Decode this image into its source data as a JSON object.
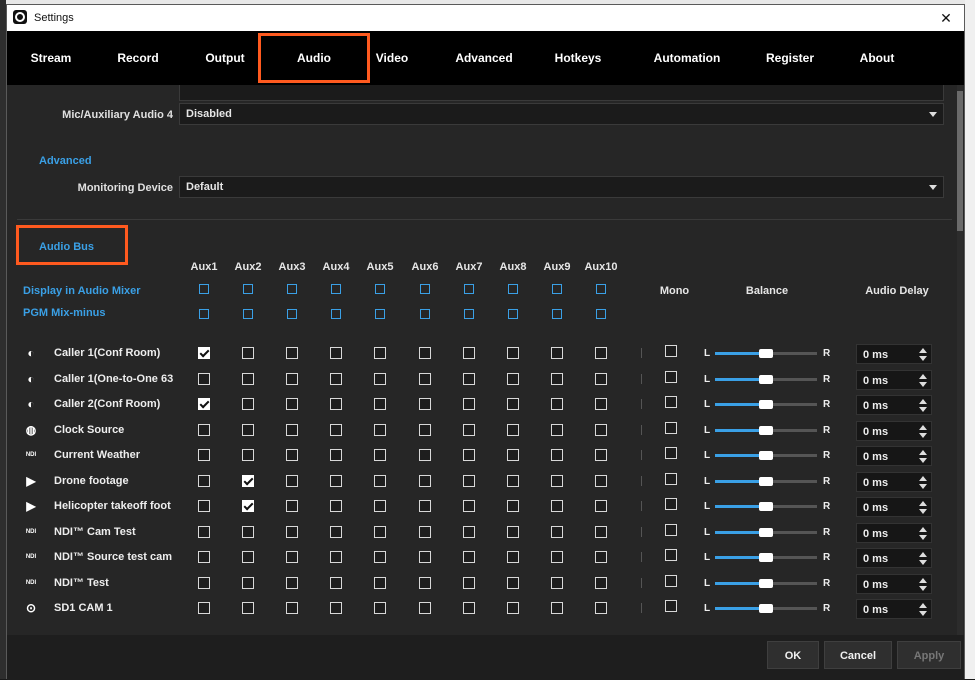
{
  "window": {
    "title": "Settings",
    "close_glyph": "✕"
  },
  "tabs": [
    {
      "label": "Stream"
    },
    {
      "label": "Record"
    },
    {
      "label": "Output"
    },
    {
      "label": "Audio"
    },
    {
      "label": "Video"
    },
    {
      "label": "Advanced"
    },
    {
      "label": "Hotkeys"
    },
    {
      "label": "Automation"
    },
    {
      "label": "Register"
    },
    {
      "label": "About"
    }
  ],
  "active_tab": "Audio",
  "mic_aux4": {
    "label": "Mic/Auxiliary Audio 4",
    "value": "Disabled"
  },
  "advanced": {
    "heading": "Advanced",
    "monitoring_label": "Monitoring Device",
    "monitoring_value": "Default"
  },
  "audio_bus": {
    "heading": "Audio Bus",
    "aux_headers": [
      "Aux1",
      "Aux2",
      "Aux3",
      "Aux4",
      "Aux5",
      "Aux6",
      "Aux7",
      "Aux8",
      "Aux9",
      "Aux10"
    ],
    "display_in_mixer_label": "Display in Audio Mixer",
    "pgm_mix_minus_label": "PGM Mix-minus",
    "mono_header": "Mono",
    "balance_header": "Balance",
    "delay_header": "Audio Delay",
    "balance_left": "L",
    "balance_right": "R",
    "sources": [
      {
        "name": "Caller 1(Conf Room)",
        "icon": "caller-icon",
        "aux": [
          true,
          false,
          false,
          false,
          false,
          false,
          false,
          false,
          false,
          false
        ],
        "mono": false,
        "balance": 0,
        "delay": "0 ms"
      },
      {
        "name": "Caller 1(One-to-One 63",
        "icon": "caller-icon",
        "aux": [
          false,
          false,
          false,
          false,
          false,
          false,
          false,
          false,
          false,
          false
        ],
        "mono": false,
        "balance": 0,
        "delay": "0 ms"
      },
      {
        "name": "Caller 2(Conf Room)",
        "icon": "caller-icon",
        "aux": [
          true,
          false,
          false,
          false,
          false,
          false,
          false,
          false,
          false,
          false
        ],
        "mono": false,
        "balance": 0,
        "delay": "0 ms"
      },
      {
        "name": "Clock Source",
        "icon": "globe-icon",
        "aux": [
          false,
          false,
          false,
          false,
          false,
          false,
          false,
          false,
          false,
          false
        ],
        "mono": false,
        "balance": 0,
        "delay": "0 ms"
      },
      {
        "name": "Current Weather",
        "icon": "ndi-icon",
        "aux": [
          false,
          false,
          false,
          false,
          false,
          false,
          false,
          false,
          false,
          false
        ],
        "mono": false,
        "balance": 0,
        "delay": "0 ms"
      },
      {
        "name": "Drone footage",
        "icon": "play-icon",
        "aux": [
          false,
          true,
          false,
          false,
          false,
          false,
          false,
          false,
          false,
          false
        ],
        "mono": false,
        "balance": 0,
        "delay": "0 ms"
      },
      {
        "name": "Helicopter takeoff foot",
        "icon": "play-icon",
        "aux": [
          false,
          true,
          false,
          false,
          false,
          false,
          false,
          false,
          false,
          false
        ],
        "mono": false,
        "balance": 0,
        "delay": "0 ms"
      },
      {
        "name": "NDI™ Cam Test",
        "icon": "ndi-icon",
        "aux": [
          false,
          false,
          false,
          false,
          false,
          false,
          false,
          false,
          false,
          false
        ],
        "mono": false,
        "balance": 0,
        "delay": "0 ms"
      },
      {
        "name": "NDI™ Source test cam",
        "icon": "ndi-icon",
        "aux": [
          false,
          false,
          false,
          false,
          false,
          false,
          false,
          false,
          false,
          false
        ],
        "mono": false,
        "balance": 0,
        "delay": "0 ms"
      },
      {
        "name": "NDI™ Test",
        "icon": "ndi-icon",
        "aux": [
          false,
          false,
          false,
          false,
          false,
          false,
          false,
          false,
          false,
          false
        ],
        "mono": false,
        "balance": 0,
        "delay": "0 ms"
      },
      {
        "name": "SD1 CAM 1",
        "icon": "camera-icon",
        "aux": [
          false,
          false,
          false,
          false,
          false,
          false,
          false,
          false,
          false,
          false
        ],
        "mono": false,
        "balance": 0,
        "delay": "0 ms"
      }
    ]
  },
  "icon_glyphs": {
    "caller-icon": "◐",
    "globe-icon": "◍",
    "ndi-icon": "NDI",
    "play-icon": "▶",
    "camera-icon": "⊙"
  },
  "footer": {
    "ok": "OK",
    "cancel": "Cancel",
    "apply": "Apply"
  },
  "colors": {
    "accent_blue": "#3aa0e6",
    "highlight_orange": "#ff5a1f"
  }
}
